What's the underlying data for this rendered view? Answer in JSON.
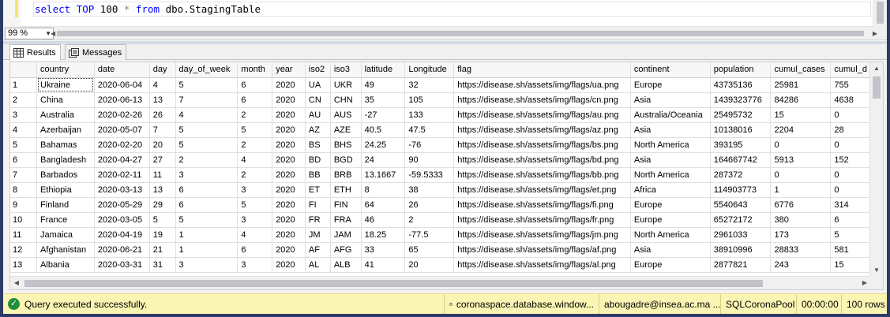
{
  "editor": {
    "tokens": [
      {
        "t": "select",
        "c": "kw"
      },
      {
        "t": " ",
        "c": "tx"
      },
      {
        "t": "TOP",
        "c": "kw"
      },
      {
        "t": " 100 ",
        "c": "tx"
      },
      {
        "t": "*",
        "c": "op"
      },
      {
        "t": " ",
        "c": "tx"
      },
      {
        "t": "from",
        "c": "kw"
      },
      {
        "t": " dbo.StagingTable",
        "c": "tx"
      }
    ]
  },
  "zoom": {
    "value": "99 %"
  },
  "tabs": [
    {
      "label": "Results",
      "icon": "grid-icon",
      "active": true
    },
    {
      "label": "Messages",
      "icon": "messages-icon",
      "active": false
    }
  ],
  "grid": {
    "columns": [
      "country",
      "date",
      "day",
      "day_of_week",
      "month",
      "year",
      "iso2",
      "iso3",
      "latitude",
      "Longitude",
      "flag",
      "continent",
      "population",
      "cumul_cases",
      "cumul_d"
    ],
    "rows": [
      [
        "1",
        "Ukraine",
        "2020-06-04",
        "4",
        "5",
        "6",
        "2020",
        "UA",
        "UKR",
        "49",
        "32",
        "https://disease.sh/assets/img/flags/ua.png",
        "Europe",
        "43735136",
        "25981",
        "755"
      ],
      [
        "2",
        "China",
        "2020-06-13",
        "13",
        "7",
        "6",
        "2020",
        "CN",
        "CHN",
        "35",
        "105",
        "https://disease.sh/assets/img/flags/cn.png",
        "Asia",
        "1439323776",
        "84286",
        "4638"
      ],
      [
        "3",
        "Australia",
        "2020-02-26",
        "26",
        "4",
        "2",
        "2020",
        "AU",
        "AUS",
        "-27",
        "133",
        "https://disease.sh/assets/img/flags/au.png",
        "Australia/Oceania",
        "25495732",
        "15",
        "0"
      ],
      [
        "4",
        "Azerbaijan",
        "2020-05-07",
        "7",
        "5",
        "5",
        "2020",
        "AZ",
        "AZE",
        "40.5",
        "47.5",
        "https://disease.sh/assets/img/flags/az.png",
        "Asia",
        "10138016",
        "2204",
        "28"
      ],
      [
        "5",
        "Bahamas",
        "2020-02-20",
        "20",
        "5",
        "2",
        "2020",
        "BS",
        "BHS",
        "24.25",
        "-76",
        "https://disease.sh/assets/img/flags/bs.png",
        "North America",
        "393195",
        "0",
        "0"
      ],
      [
        "6",
        "Bangladesh",
        "2020-04-27",
        "27",
        "2",
        "4",
        "2020",
        "BD",
        "BGD",
        "24",
        "90",
        "https://disease.sh/assets/img/flags/bd.png",
        "Asia",
        "164667742",
        "5913",
        "152"
      ],
      [
        "7",
        "Barbados",
        "2020-02-11",
        "11",
        "3",
        "2",
        "2020",
        "BB",
        "BRB",
        "13.1667",
        "-59.5333",
        "https://disease.sh/assets/img/flags/bb.png",
        "North America",
        "287372",
        "0",
        "0"
      ],
      [
        "8",
        "Ethiopia",
        "2020-03-13",
        "13",
        "6",
        "3",
        "2020",
        "ET",
        "ETH",
        "8",
        "38",
        "https://disease.sh/assets/img/flags/et.png",
        "Africa",
        "114903773",
        "1",
        "0"
      ],
      [
        "9",
        "Finland",
        "2020-05-29",
        "29",
        "6",
        "5",
        "2020",
        "FI",
        "FIN",
        "64",
        "26",
        "https://disease.sh/assets/img/flags/fi.png",
        "Europe",
        "5540643",
        "6776",
        "314"
      ],
      [
        "10",
        "France",
        "2020-03-05",
        "5",
        "5",
        "3",
        "2020",
        "FR",
        "FRA",
        "46",
        "2",
        "https://disease.sh/assets/img/flags/fr.png",
        "Europe",
        "65272172",
        "380",
        "6"
      ],
      [
        "11",
        "Jamaica",
        "2020-04-19",
        "19",
        "1",
        "4",
        "2020",
        "JM",
        "JAM",
        "18.25",
        "-77.5",
        "https://disease.sh/assets/img/flags/jm.png",
        "North America",
        "2961033",
        "173",
        "5"
      ],
      [
        "12",
        "Afghanistan",
        "2020-06-21",
        "21",
        "1",
        "6",
        "2020",
        "AF",
        "AFG",
        "33",
        "65",
        "https://disease.sh/assets/img/flags/af.png",
        "Asia",
        "38910996",
        "28833",
        "581"
      ],
      [
        "13",
        "Albania",
        "2020-03-31",
        "31",
        "3",
        "3",
        "2020",
        "AL",
        "ALB",
        "41",
        "20",
        "https://disease.sh/assets/img/flags/al.png",
        "Europe",
        "2877821",
        "243",
        "15"
      ]
    ]
  },
  "status": {
    "message": "Query executed successfully.",
    "server": "coronaspace.database.window...",
    "user": "abougadre@insea.ac.ma ...",
    "database": "SQLCoronaPool",
    "elapsed": "00:00:00",
    "rows": "100 rows"
  },
  "colors": {
    "keyword": "#0000ff",
    "status_bar": "#fbf5b4",
    "success": "#1f8f3a"
  }
}
